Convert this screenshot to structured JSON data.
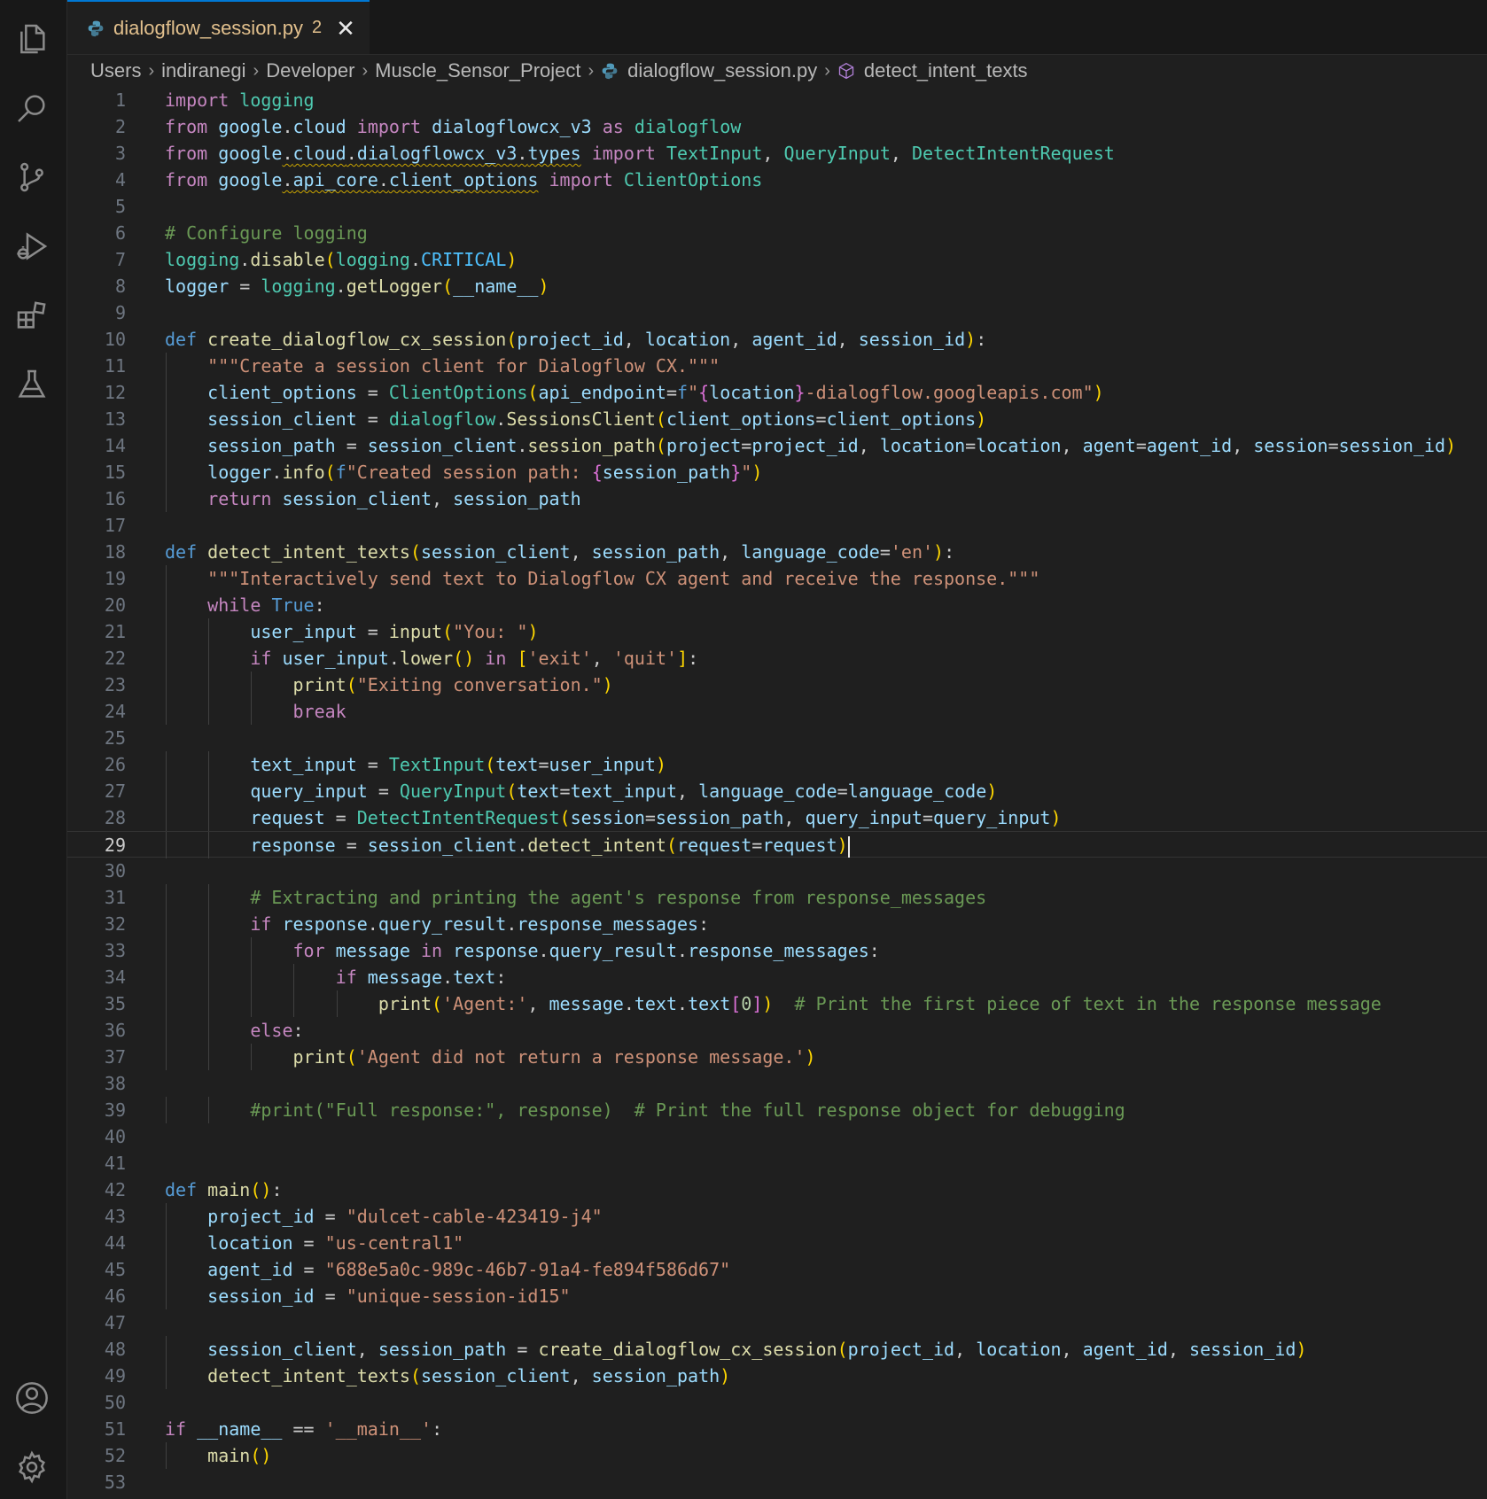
{
  "tab": {
    "title": "dialogflow_session.py",
    "badge": "2",
    "close": "✕"
  },
  "breadcrumb": [
    "Users",
    "indiranegi",
    "Developer",
    "Muscle_Sensor_Project",
    "dialogflow_session.py",
    "detect_intent_texts"
  ],
  "colors": {
    "tab_active": "#e2c08d",
    "accent": "#0078d4",
    "background": "#1f1f1f"
  },
  "icons": [
    "explorer-icon",
    "search-icon",
    "source-control-icon",
    "run-debug-icon",
    "extensions-icon",
    "testing-icon",
    "account-icon",
    "settings-gear-icon",
    "python-file-icon",
    "symbol-method-icon",
    "close-icon"
  ],
  "editor": {
    "current_line": 29,
    "lines": [
      "import logging",
      "from google.cloud import dialogflowcx_v3 as dialogflow",
      "from google.cloud.dialogflowcx_v3.types import TextInput, QueryInput, DetectIntentRequest",
      "from google.api_core.client_options import ClientOptions",
      "",
      "# Configure logging",
      "logging.disable(logging.CRITICAL)",
      "logger = logging.getLogger(__name__)",
      "",
      "def create_dialogflow_cx_session(project_id, location, agent_id, session_id):",
      "    \"\"\"Create a session client for Dialogflow CX.\"\"\"",
      "    client_options = ClientOptions(api_endpoint=f\"{location}-dialogflow.googleapis.com\")",
      "    session_client = dialogflow.SessionsClient(client_options=client_options)",
      "    session_path = session_client.session_path(project=project_id, location=location, agent=agent_id, session=session_id)",
      "    logger.info(f\"Created session path: {session_path}\")",
      "    return session_client, session_path",
      "",
      "def detect_intent_texts(session_client, session_path, language_code='en'):",
      "    \"\"\"Interactively send text to Dialogflow CX agent and receive the response.\"\"\"",
      "    while True:",
      "        user_input = input(\"You: \")",
      "        if user_input.lower() in ['exit', 'quit']:",
      "            print(\"Exiting conversation.\")",
      "            break",
      "",
      "        text_input = TextInput(text=user_input)",
      "        query_input = QueryInput(text=text_input, language_code=language_code)",
      "        request = DetectIntentRequest(session=session_path, query_input=query_input)",
      "        response = session_client.detect_intent(request=request)",
      "",
      "        # Extracting and printing the agent's response from response_messages",
      "        if response.query_result.response_messages:",
      "            for message in response.query_result.response_messages:",
      "                if message.text:",
      "                    print('Agent:', message.text.text[0])  # Print the first piece of text in the response message",
      "        else:",
      "            print('Agent did not return a response message.')",
      "",
      "        #print(\"Full response:\", response)  # Print the full response object for debugging",
      "",
      "",
      "def main():",
      "    project_id = \"dulcet-cable-423419-j4\"",
      "    location = \"us-central1\"",
      "    agent_id = \"688e5a0c-989c-46b7-91a4-fe894f586d67\"",
      "    session_id = \"unique-session-id15\"",
      "",
      "    session_client, session_path = create_dialogflow_cx_session(project_id, location, agent_id, session_id)",
      "    detect_intent_texts(session_client, session_path)",
      "",
      "if __name__ == '__main__':",
      "    main()",
      ""
    ]
  }
}
